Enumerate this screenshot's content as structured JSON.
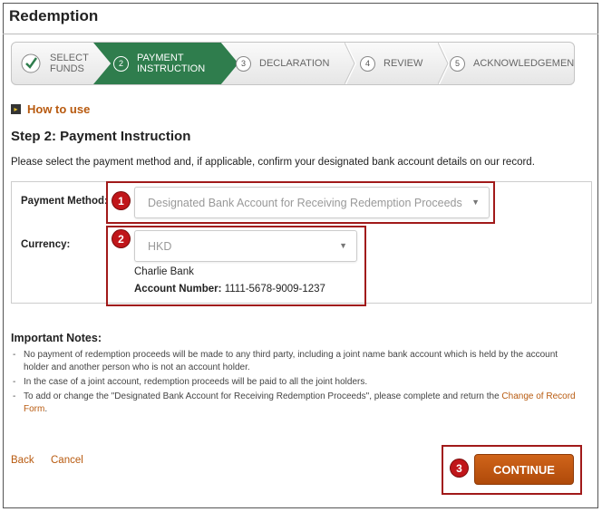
{
  "page": {
    "title": "Redemption"
  },
  "stepper": {
    "steps": [
      {
        "num": "",
        "label_line1": "SELECT",
        "label_line2": "FUNDS",
        "state": "done"
      },
      {
        "num": "2",
        "label_line1": "PAYMENT",
        "label_line2": "INSTRUCTION",
        "state": "active"
      },
      {
        "num": "3",
        "label_line1": "DECLARATION",
        "label_line2": "",
        "state": "pending"
      },
      {
        "num": "4",
        "label_line1": "REVIEW",
        "label_line2": "",
        "state": "pending"
      },
      {
        "num": "5",
        "label_line1": "ACKNOWLEDGEMENT",
        "label_line2": "",
        "state": "pending"
      }
    ],
    "active_color": "#2f7d4d"
  },
  "how_to_use": {
    "label": "How to use"
  },
  "section": {
    "title": "Step 2: Payment Instruction",
    "instructions": "Please select the payment method and, if applicable, confirm your designated bank account details on our record."
  },
  "form": {
    "payment_method_label": "Payment Method:",
    "payment_method_value": "Designated Bank Account for Receiving Redemption Proceeds",
    "currency_label": "Currency:",
    "currency_value": "HKD",
    "bank_name": "Charlie Bank",
    "account_number_label": "Account Number:",
    "account_number_value": "1111-5678-9009-1237"
  },
  "annotations": {
    "badge1": "1",
    "badge2": "2",
    "badge3": "3",
    "highlight_color": "#a11a1a"
  },
  "notes": {
    "title": "Important Notes:",
    "items": [
      "No payment of redemption proceeds will be made to any third party, including a joint name bank account which is held by the account holder and another person who is not an account holder.",
      "In the case of a joint account, redemption proceeds will be paid to all the joint holders."
    ],
    "item3_prefix": "To add or change the \"Designated Bank Account for Receiving Redemption Proceeds\", please complete and return the ",
    "item3_link": "Change of Record Form",
    "item3_suffix": "."
  },
  "actions": {
    "back": "Back",
    "cancel": "Cancel",
    "continue": "CONTINUE",
    "accent_color": "#b85a0f"
  }
}
